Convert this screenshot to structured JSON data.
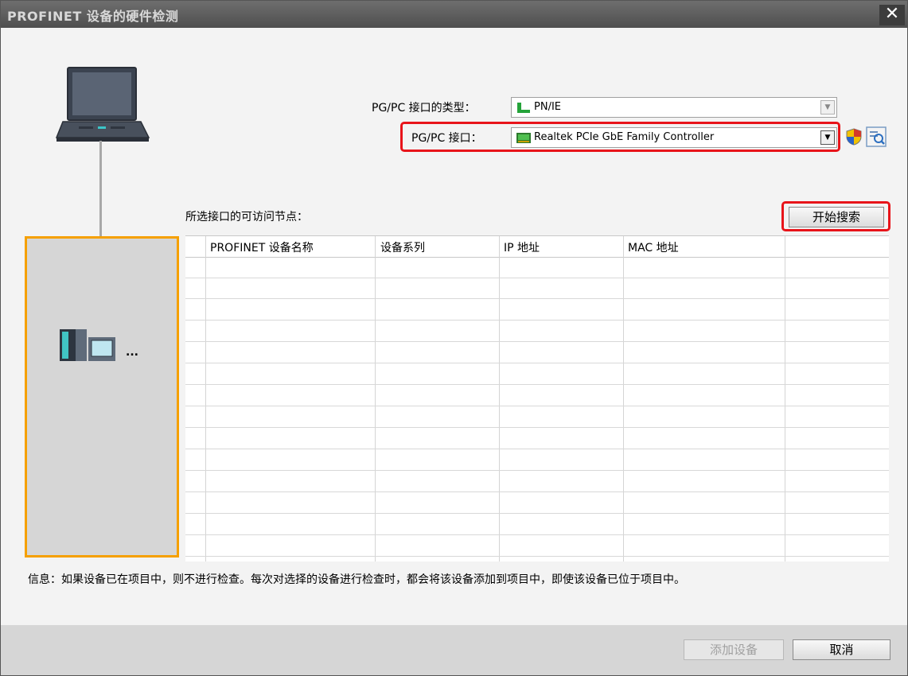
{
  "window": {
    "title": "PROFINET 设备的硬件检测",
    "close_glyph": "✕"
  },
  "interface_type": {
    "label": "PG/PC 接口的类型：",
    "value": "PN/IE",
    "icon": "network-plug-icon"
  },
  "interface": {
    "label": "PG/PC 接口：",
    "value": "Realtek PCIe GbE Family Controller",
    "icon": "network-card-icon"
  },
  "nodes_label": "所选接口的可访问节点：",
  "search_button": "开始搜索",
  "table": {
    "columns": [
      "PROFINET 设备名称",
      "设备系列",
      "IP 地址",
      "MAC 地址"
    ],
    "rows": []
  },
  "device_ellipsis": "...",
  "info_text": "信息：如果设备已在项目中，则不进行检查。每次对选择的设备进行检查时，都会将该设备添加到项目中，即使该设备已位于项目中。",
  "footer": {
    "add_device": "添加设备",
    "cancel": "取消"
  },
  "colors": {
    "highlight_red": "#e8141a",
    "panel_orange": "#f5a000",
    "title_bar": "#5a5a5a"
  }
}
